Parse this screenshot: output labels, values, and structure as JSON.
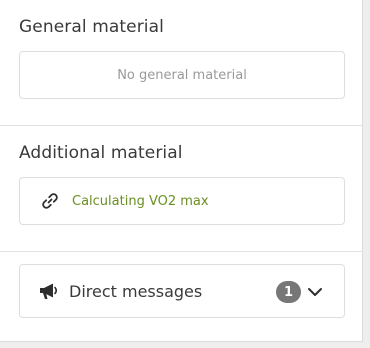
{
  "general": {
    "title": "General material",
    "empty_text": "No general material"
  },
  "additional": {
    "title": "Additional material",
    "items": [
      {
        "label": "Calculating VO2 max",
        "icon": "link-icon"
      }
    ]
  },
  "messages": {
    "label": "Direct messages",
    "count": "1",
    "icon": "megaphone-icon",
    "toggle_icon": "chevron-down-icon"
  },
  "colors": {
    "link": "#6b8e23",
    "badge": "#777777",
    "border": "#dedede"
  }
}
